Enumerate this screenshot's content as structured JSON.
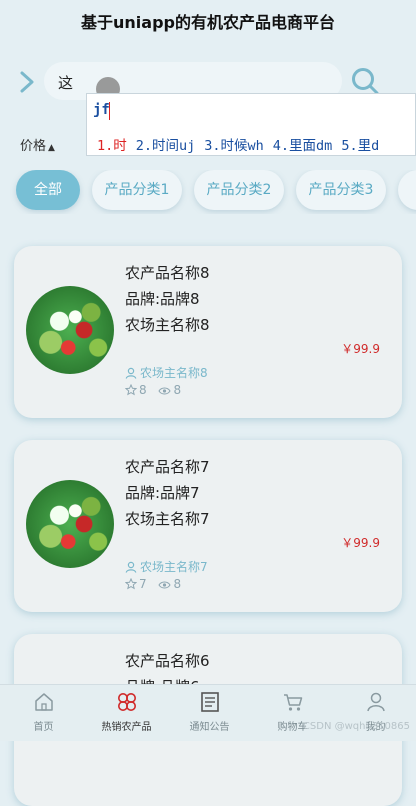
{
  "app": {
    "title": "基于uniapp的有机农产品电商平台"
  },
  "search": {
    "value": "这",
    "placeholder": ""
  },
  "ime": {
    "pinyin": "jf",
    "candidates": [
      "1.时",
      "2.时间uj",
      "3.时候wh",
      "4.里面dm",
      "5.里d"
    ]
  },
  "sort": {
    "label": "价格",
    "arrow": "▲"
  },
  "categories": [
    "全部",
    "产品分类1",
    "产品分类2",
    "产品分类3"
  ],
  "products": [
    {
      "name": "农产品名称8",
      "brand": "品牌:品牌8",
      "farm": "农场主名称8",
      "price": "￥99.9",
      "owner": "农场主名称8",
      "likes": "8",
      "views": "8"
    },
    {
      "name": "农产品名称7",
      "brand": "品牌:品牌7",
      "farm": "农场主名称7",
      "price": "￥99.9",
      "owner": "农场主名称7",
      "likes": "7",
      "views": "8"
    },
    {
      "name": "农产品名称6",
      "brand": "品牌:品牌6",
      "farm": "",
      "price": "",
      "owner": "",
      "likes": "",
      "views": ""
    }
  ],
  "tabbar": [
    "首页",
    "热销农产品",
    "通知公告",
    "购物车",
    "我的"
  ],
  "watermark": "CSDN @wqhb310865",
  "colors": {
    "accent": "#77bfd5",
    "price": "#d02a2a",
    "background": "#e4eff3"
  },
  "icons": [
    "chevron-right-icon",
    "search-icon",
    "user-icon",
    "star-icon",
    "eye-icon",
    "home-icon",
    "flower-icon",
    "newspaper-icon",
    "cart-icon",
    "person-icon"
  ]
}
